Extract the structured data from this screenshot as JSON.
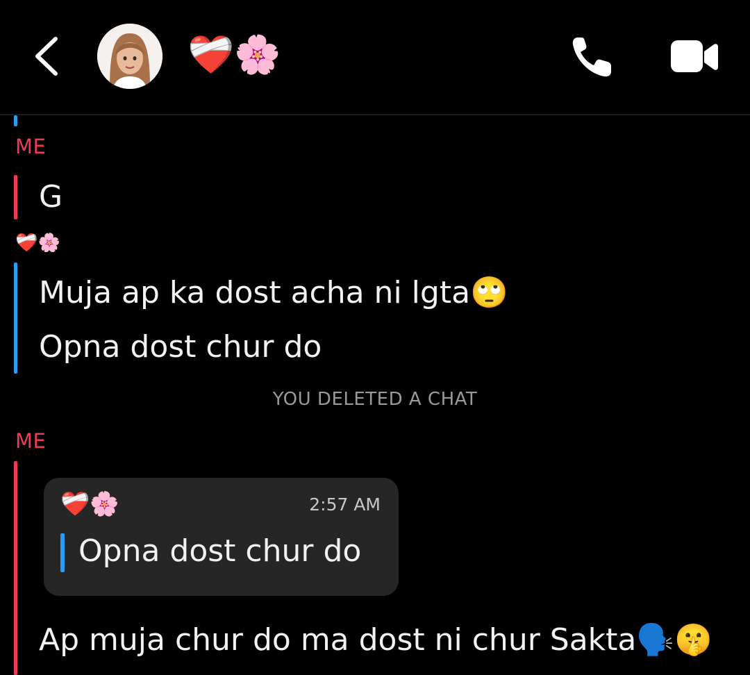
{
  "header": {
    "chat_title": "❤️‍🩹🌸"
  },
  "thread": {
    "block1": {
      "sender": "ME",
      "messages": [
        "G"
      ]
    },
    "block2": {
      "sender": "❤️‍🩹🌸",
      "messages": [
        "Muja ap ka dost acha ni lgta🙄",
        "Opna dost chur do"
      ]
    },
    "system_notice": "YOU DELETED A CHAT",
    "block3": {
      "sender": "ME",
      "quoted": {
        "sender": "❤️‍🩹🌸",
        "time": "2:57 AM",
        "text": "Opna dost chur do"
      },
      "messages": [
        "Ap muja chur do ma dost ni chur Sakta🗣️🤫"
      ]
    }
  },
  "colors": {
    "me": "#ee3a57",
    "friend": "#2b9df0",
    "background": "#000000",
    "quote_bg": "#262626",
    "system_text": "#9a9a9a"
  },
  "icons": [
    "back-chevron-icon",
    "avatar-bitmoji",
    "phone-icon",
    "video-camera-icon"
  ]
}
